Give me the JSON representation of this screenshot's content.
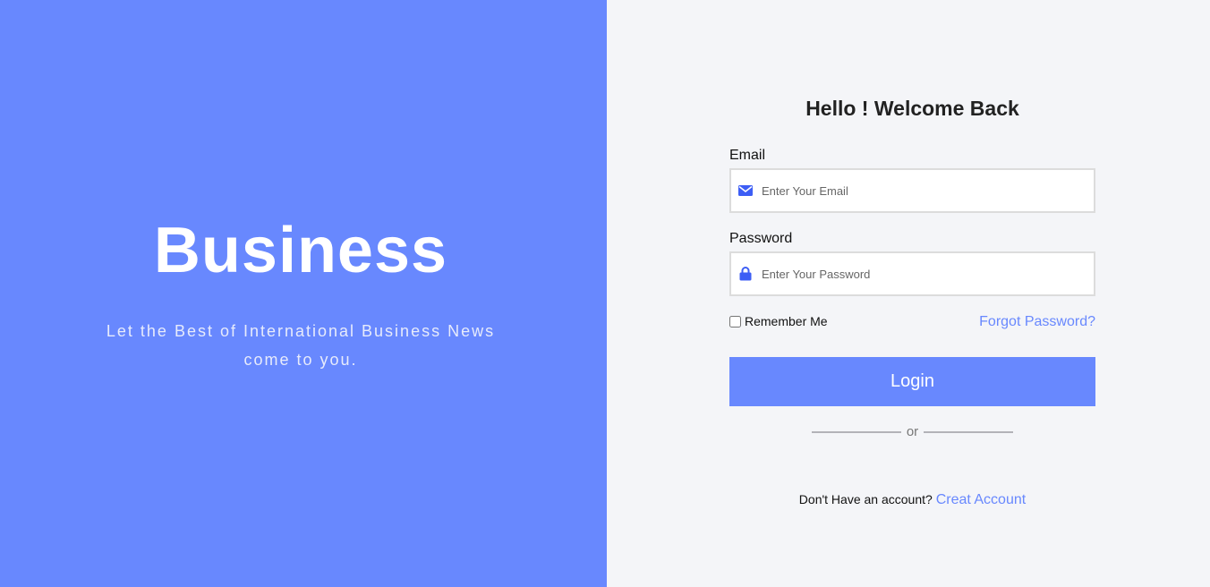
{
  "left_panel": {
    "brand_title": "Business",
    "tagline": "Let the Best of International Business News come to you."
  },
  "login_form": {
    "heading": "Hello ! Welcome Back",
    "email_label": "Email",
    "email_placeholder": "Enter Your Email",
    "password_label": "Password",
    "password_placeholder": "Enter Your Password",
    "remember_label": "Remember Me",
    "remember_checked": false,
    "forgot_link": "Forgot Password?",
    "login_button": "Login",
    "divider_text": "or",
    "signup_prompt": "Don't Have an account?",
    "signup_link": "Creat Account"
  },
  "icons": {
    "email": "envelope-icon",
    "password": "lock-icon"
  },
  "colors": {
    "accent": "#6888fe",
    "icon": "#3d5ef5",
    "right_background": "#f4f5f8",
    "text_dark": "#222222"
  }
}
